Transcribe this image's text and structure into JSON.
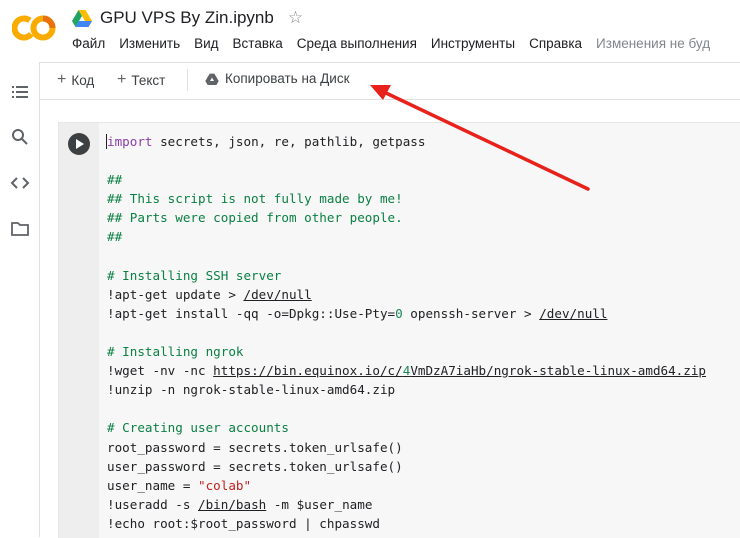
{
  "app": {
    "title": "GPU VPS By Zin.ipynb",
    "logo_text": "CO",
    "colors": {
      "logo_orange": "#F9AB00",
      "logo_deep": "#E8710A",
      "arrow": "#E8221B"
    }
  },
  "menu": {
    "items": [
      "Файл",
      "Изменить",
      "Вид",
      "Вставка",
      "Среда выполнения",
      "Инструменты",
      "Справка"
    ],
    "status": "Изменения не буд"
  },
  "toolbar": {
    "code_label": "Код",
    "text_label": "Текст",
    "copy_label": "Копировать на Диск"
  },
  "sidebar": {
    "icons": [
      "toc-icon",
      "search-icon",
      "code-snippets-icon",
      "folder-icon"
    ]
  },
  "code": {
    "l01_kw": "import",
    "l01_rest": " secrets, json, re, pathlib, getpass",
    "l03": "##",
    "l04": "## This script is not fully made by me!",
    "l05": "## Parts were copied from other people.",
    "l06": "##",
    "l08": "# Installing SSH server",
    "l09_a": "!apt-get update > ",
    "l09_b": "/dev/null",
    "l10_a": "!apt-get install -qq -o=Dpkg::Use-Pty=",
    "l10_num": "0",
    "l10_b": " openssh-server > ",
    "l10_c": "/dev/null",
    "l12": "# Installing ngrok",
    "l13_a": "!wget -nv -nc ",
    "l13_url_a": "https://bin.equinox.io/c/",
    "l13_url_num": "4",
    "l13_url_b": "VmDzA7iaHb/ngrok-stable-linux-amd64.zip",
    "l14": "!unzip -n ngrok-stable-linux-amd64.zip",
    "l16": "# Creating user accounts",
    "l17": "root_password = secrets.token_urlsafe()",
    "l18": "user_password = secrets.token_urlsafe()",
    "l19_a": "user_name = ",
    "l19_str": "\"colab\"",
    "l20_a": "!useradd -s ",
    "l20_b": "/bin/bash",
    "l20_c": " -m $user_name",
    "l21": "!echo root:$root_password | chpasswd"
  }
}
